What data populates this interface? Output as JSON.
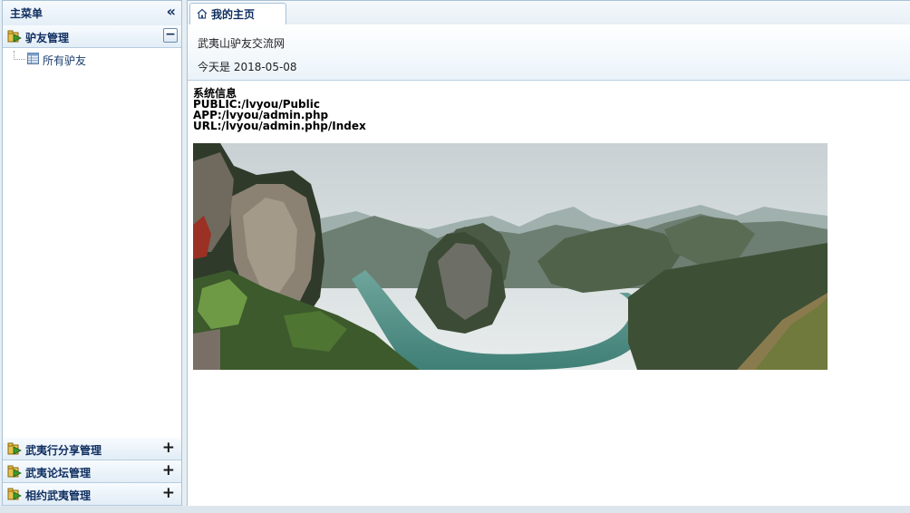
{
  "sidebar": {
    "title": "主菜单",
    "collapse_icon": "double-chevron-left-icon",
    "panels": [
      {
        "label": "驴友管理",
        "expanded": true,
        "toggle": "−",
        "items": [
          {
            "label": "所有驴友",
            "icon": "table-icon"
          }
        ]
      },
      {
        "label": "武夷行分享管理",
        "expanded": false,
        "toggle": "+"
      },
      {
        "label": "武夷论坛管理",
        "expanded": false,
        "toggle": "+"
      },
      {
        "label": "相约武夷管理",
        "expanded": false,
        "toggle": "+"
      }
    ]
  },
  "main": {
    "tab": {
      "label": "我的主页",
      "icon": "home-icon"
    },
    "info": {
      "site_name": "武夷山驴友交流网",
      "today": "今天是 2018-05-08"
    },
    "sysinfo": {
      "title": "系统信息",
      "public": "PUBLIC:/lvyou/Public",
      "app": "APP:/lvyou/admin.php",
      "url": "URL:/lvyou/admin.php/Index"
    }
  },
  "colors": {
    "header_text": "#0e2d5f",
    "border": "#a9c1d5",
    "river": "#4f8f86"
  }
}
